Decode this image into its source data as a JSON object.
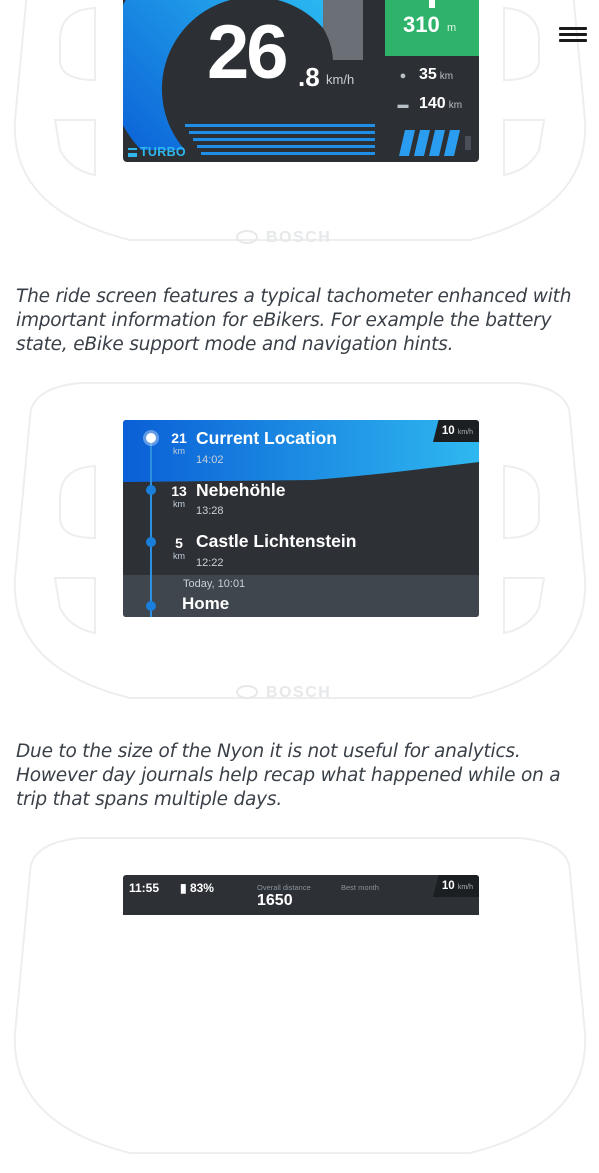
{
  "nav": {
    "menu_icon": "hamburger-menu-icon"
  },
  "screen_ride": {
    "speed_whole": "26",
    "speed_decimal": ".8",
    "speed_unit": "km/h",
    "mode": "TURBO",
    "nav_distance": "310",
    "nav_distance_unit": "m",
    "range_value": "35",
    "range_unit": "km",
    "trip_value": "140",
    "trip_unit": "km",
    "battery_bars": 4,
    "colors": {
      "accent": "#2fb8f0",
      "nav_green": "#2fb36a",
      "screen_bg": "#2c3034"
    }
  },
  "brand": {
    "name": "BOSCH"
  },
  "captions": {
    "ride": "The ride screen features a typical tachometer enhanced with important information for eBikers. For example the battery state, eBike support mode and navigation hints.",
    "journal": "Due to the size of the Nyon it is not useful for analytics. However day journals help recap what happened while on a trip that spans multiple days."
  },
  "screen_route": {
    "speed_value": "10",
    "speed_unit": "km/h",
    "stops": [
      {
        "distance": "21",
        "unit": "km",
        "name": "Current Location",
        "time": "14:02"
      },
      {
        "distance": "13",
        "unit": "km",
        "name": "Nebehöhle",
        "time": "13:28"
      },
      {
        "distance": "5",
        "unit": "km",
        "name": "Castle Lichtenstein",
        "time": "12:22"
      }
    ],
    "home": {
      "time": "Today, 10:01",
      "name": "Home"
    }
  },
  "screen_journal": {
    "clock": "11:55",
    "battery": "83%",
    "overall_label": "Overall distance",
    "best_label": "Best month",
    "overall_value": "1650",
    "speed_value": "10",
    "speed_unit": "km/h"
  }
}
